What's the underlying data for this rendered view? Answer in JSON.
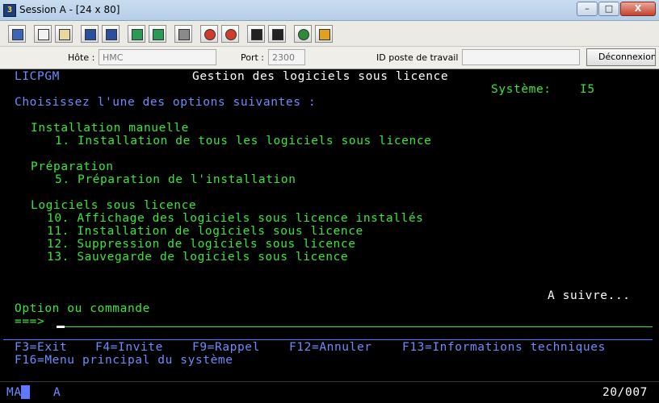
{
  "window": {
    "title": "Session A - [24 x 80]",
    "icon_text": "3",
    "min_glyph": "–",
    "max_glyph": "□",
    "close_glyph": "X"
  },
  "toolbar": {
    "buttons": [
      "copy",
      "paste",
      "cut",
      "send",
      "receive",
      "display",
      "print",
      "keyboard",
      "macro-record",
      "macro-play",
      "macro-stop",
      "macro-run",
      "globe",
      "support"
    ]
  },
  "connection": {
    "host_label": "Hôte :",
    "host_value": "HMC",
    "port_label": "Port :",
    "port_value": "2300",
    "workstation_label": "ID poste de travail :",
    "workstation_value": "",
    "disconnect_label": "Déconnexion"
  },
  "screen": {
    "program": "LICPGM",
    "title": "Gestion des logiciels sous licence",
    "system_label": "Système:",
    "system_value": "I5",
    "prompt": "Choisissez l'une des options suivantes :",
    "sections": [
      {
        "heading": "Installation manuelle",
        "options": [
          "1. Installation de tous les logiciels sous licence"
        ]
      },
      {
        "heading": "Préparation",
        "options": [
          "5. Préparation de l'installation"
        ]
      },
      {
        "heading": "Logiciels sous licence",
        "options": [
          "10. Affichage des logiciels sous licence installés",
          "11. Installation de logiciels sous licence",
          "12. Suppression de logiciels sous licence",
          "13. Sauvegarde de logiciels sous licence"
        ]
      }
    ],
    "more": "A suivre...",
    "command_label": "Option ou commande",
    "command_prompt": "===>",
    "fkeys_line1": [
      "F3=Exit",
      "F4=Invite",
      "F9=Rappel",
      "F12=Annuler",
      "F13=Informations techniques"
    ],
    "fkeys_line2": [
      "F16=Menu principal du système"
    ]
  },
  "status": {
    "mode": "MA",
    "indicator": "A",
    "cursor_pos": "20/007"
  }
}
